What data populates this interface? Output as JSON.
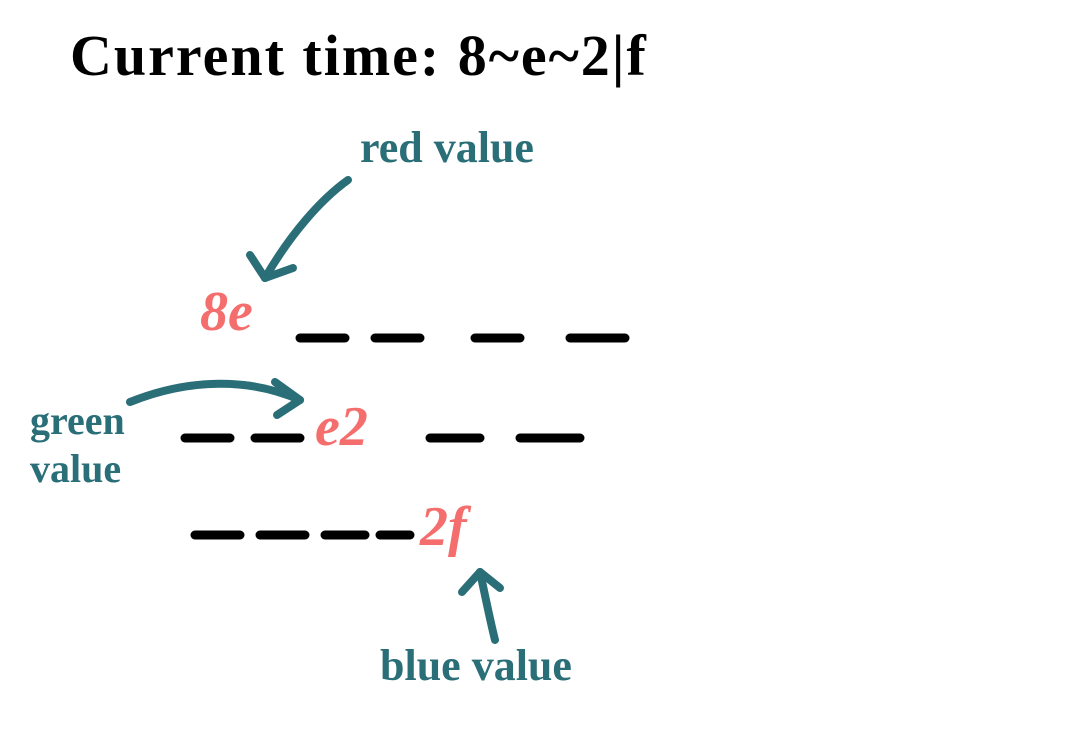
{
  "title": "Current time: 8~e~2|f",
  "labels": {
    "red": "red value",
    "green_line1": "green",
    "green_line2": "value",
    "blue": "blue value"
  },
  "hex": {
    "r": "8e",
    "g": "e2",
    "b": "2f"
  }
}
